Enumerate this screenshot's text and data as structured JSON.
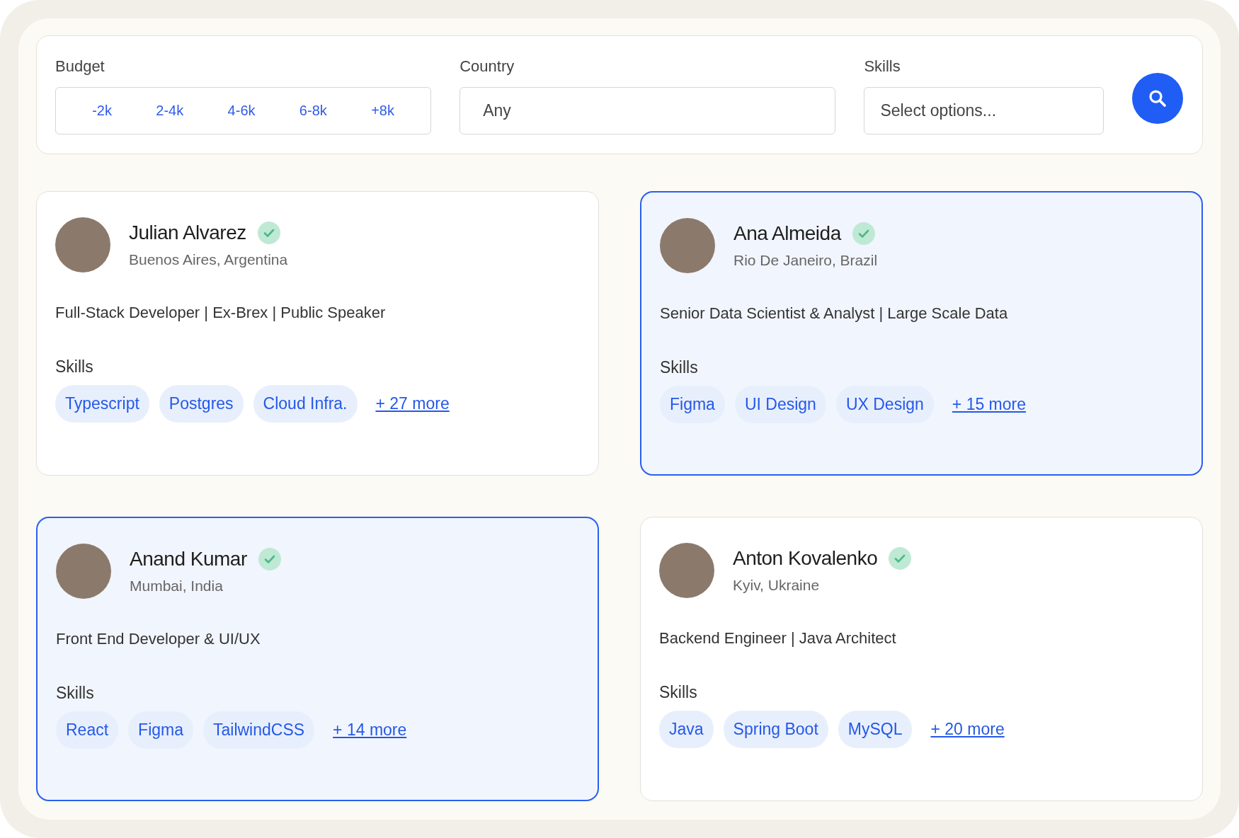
{
  "filters": {
    "budget": {
      "label": "Budget",
      "options": [
        "-2k",
        "2-4k",
        "4-6k",
        "6-8k",
        "+8k"
      ]
    },
    "country": {
      "label": "Country",
      "value": "Any"
    },
    "skills": {
      "label": "Skills",
      "placeholder": "Select options..."
    }
  },
  "profiles": [
    {
      "name": "Julian Alvarez",
      "verified": true,
      "location": "Buenos Aires, Argentina",
      "headline": "Full-Stack Developer | Ex-Brex | Public Speaker",
      "skills_label": "Skills",
      "skills": [
        "Typescript",
        "Postgres",
        "Cloud Infra."
      ],
      "more": "+ 27 more",
      "selected": false
    },
    {
      "name": "Ana Almeida",
      "verified": true,
      "location": "Rio De Janeiro, Brazil",
      "headline": "Senior Data Scientist & Analyst | Large Scale Data",
      "skills_label": "Skills",
      "skills": [
        "Figma",
        "UI Design",
        "UX Design"
      ],
      "more": "+ 15 more",
      "selected": true
    },
    {
      "name": "Anand Kumar",
      "verified": true,
      "location": "Mumbai, India",
      "headline": "Front End Developer & UI/UX",
      "skills_label": "Skills",
      "skills": [
        "React",
        "Figma",
        "TailwindCSS"
      ],
      "more": "+ 14 more",
      "selected": true
    },
    {
      "name": "Anton Kovalenko",
      "verified": true,
      "location": "Kyiv, Ukraine",
      "headline": "Backend Engineer | Java Architect",
      "skills_label": "Skills",
      "skills": [
        "Java",
        "Spring Boot",
        "MySQL"
      ],
      "more": "+ 20 more",
      "selected": false
    }
  ]
}
